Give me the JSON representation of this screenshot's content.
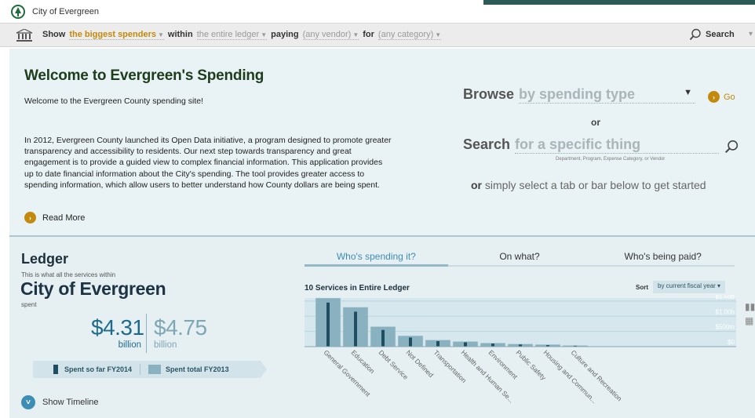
{
  "app": {
    "title": "City of Evergreen"
  },
  "filter": {
    "show_kw": "Show",
    "show_value": "the biggest spenders",
    "within_kw": "within",
    "within_value": "the entire ledger",
    "paying_kw": "paying",
    "paying_value": "(any vendor)",
    "for_kw": "for",
    "for_value": "(any category)",
    "search_label": "Search"
  },
  "welcome": {
    "heading": "Welcome to Evergreen's Spending",
    "lead": "Welcome to the Evergreen County spending site!",
    "body": "In 2012, Evergreen County launched its Open Data initiative, a program designed to promote greater transparency and accessibility to residents. Our next step towards transparency and great engagement is to provide a guided view to complex financial information. This application provides up to date financial information about the City's spending. The tool provides greater access to spending information, which allow users to better understand how County dollars are being spent.",
    "read_more": "Read More",
    "browse_kw": "Browse",
    "browse_value": "by spending type",
    "go_label": "Go",
    "or_label": "or",
    "search_kw": "Search",
    "search_placeholder": "for a specific thing",
    "search_hint": "Department, Program, Expense Category, or Vendor",
    "or_simply_bold": "or",
    "or_simply_rest": " simply select a tab or bar below to get started"
  },
  "ledger": {
    "heading": "Ledger",
    "subline": "This is what all the services within",
    "city": "City of Evergreen",
    "spent_label": "spent",
    "amount_current": "$4.31",
    "amount_current_unit": "billion",
    "amount_previous": "$4.75",
    "amount_previous_unit": "billion",
    "legend_current": "Spent so far FY2014",
    "legend_previous": "Spent total FY2013",
    "show_timeline": "Show Timeline"
  },
  "tabs": [
    {
      "label": "Who's spending it?",
      "active": true
    },
    {
      "label": "On what?",
      "active": false
    },
    {
      "label": "Who's being paid?",
      "active": false
    }
  ],
  "chart_header": {
    "title": "10 Services in Entire Ledger",
    "sort_label": "Sort",
    "sort_value": "by current fiscal year"
  },
  "chart_data": {
    "type": "bar",
    "title": "10 Services in Entire Ledger",
    "categories": [
      "General Government",
      "Education",
      "Debt Service",
      "Not Defined",
      "Transportation",
      "Health and Human Se...",
      "Environment",
      "Public Safety",
      "Housing and Commun...",
      "Culture and Recreation"
    ],
    "y_ticks": [
      "$0",
      "$500m",
      "$1.00b",
      "$1.50b"
    ],
    "ylim": [
      0,
      1.6
    ],
    "series": [
      {
        "name": "Spent so far FY2014",
        "values": [
          1.45,
          1.15,
          0.55,
          0.3,
          0.18,
          0.14,
          0.1,
          0.07,
          0.05,
          0.03
        ]
      },
      {
        "name": "Spent total FY2013",
        "values": [
          1.6,
          1.3,
          0.66,
          0.36,
          0.22,
          0.17,
          0.12,
          0.09,
          0.07,
          0.04
        ]
      }
    ],
    "colors": {
      "current": "#1e4e60",
      "previous": "#8ab1bf"
    }
  }
}
